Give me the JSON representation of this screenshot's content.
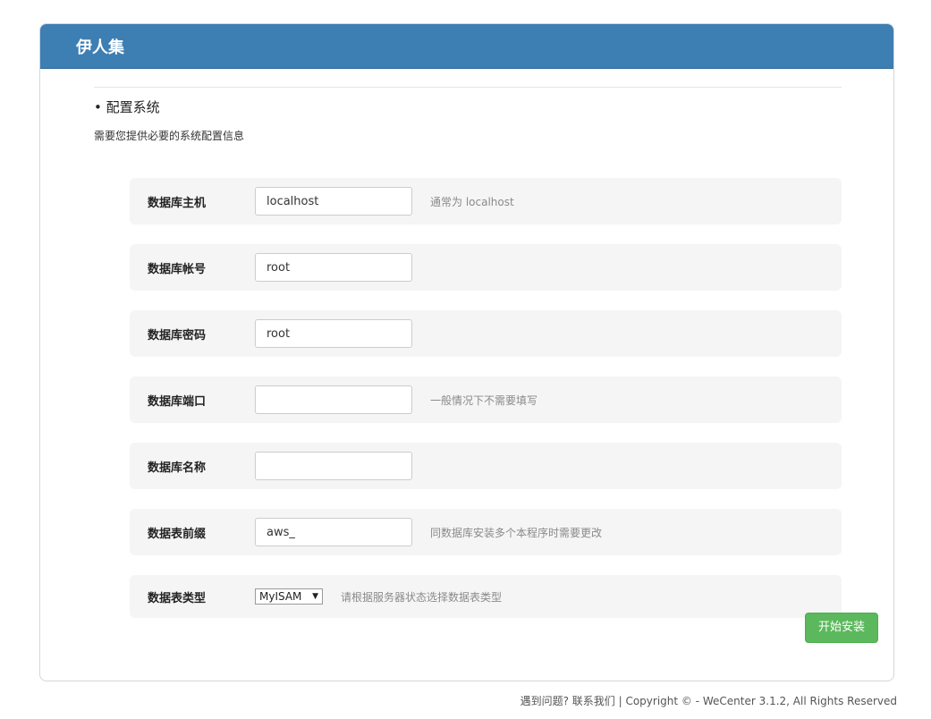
{
  "header": {
    "title": "伊人集"
  },
  "section": {
    "title": "• 配置系统",
    "description": "需要您提供必要的系统配置信息"
  },
  "fields": [
    {
      "label": "数据库主机",
      "value": "localhost",
      "help": "通常为 localhost"
    },
    {
      "label": "数据库帐号",
      "value": "root",
      "help": ""
    },
    {
      "label": "数据库密码",
      "value": "root",
      "help": ""
    },
    {
      "label": "数据库端口",
      "value": "",
      "help": "一般情况下不需要填写"
    },
    {
      "label": "数据库名称",
      "value": "",
      "help": ""
    },
    {
      "label": "数据表前缀",
      "value": "aws_",
      "help": "同数据库安装多个本程序时需要更改"
    }
  ],
  "engine": {
    "label": "数据表类型",
    "selected": "MyISAM",
    "help": "请根据服务器状态选择数据表类型"
  },
  "actions": {
    "submit_label": "开始安装"
  },
  "footer": {
    "text": "遇到问题? 联系我们 | Copyright © - WeCenter 3.1.2, All Rights Reserved"
  },
  "colors": {
    "header_bg": "#3d7eb3",
    "row_bg": "#f5f5f5",
    "submit_bg": "#5cb85c"
  }
}
